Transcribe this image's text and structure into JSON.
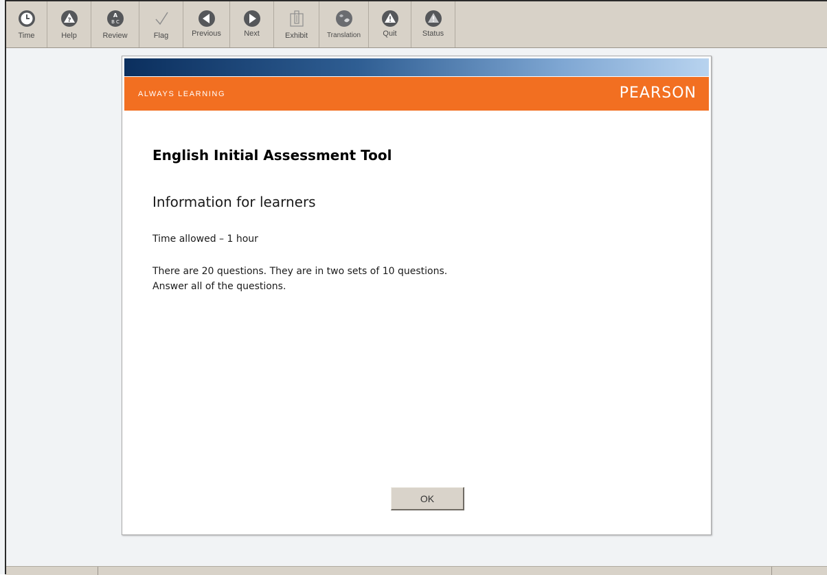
{
  "toolbar": {
    "buttons": [
      {
        "label": "Time",
        "icon": "clock-icon"
      },
      {
        "label": "Help",
        "icon": "help-icon"
      },
      {
        "label": "Review",
        "icon": "review-icon"
      },
      {
        "label": "Flag",
        "icon": "checkmark-icon"
      },
      {
        "label": "Previous",
        "icon": "arrow-left-icon"
      },
      {
        "label": "Next",
        "icon": "arrow-right-icon"
      },
      {
        "label": "Exhibit",
        "icon": "exhibit-icon"
      },
      {
        "label": "Translation",
        "icon": "translation-icon"
      },
      {
        "label": "Quit",
        "icon": "warning-icon"
      },
      {
        "label": "Status",
        "icon": "status-icon"
      }
    ]
  },
  "dialog": {
    "banner_tagline": "ALWAYS LEARNING",
    "brand": "PEARSON",
    "title": "English Initial Assessment Tool",
    "subtitle": "Information for learners",
    "time_allowed": "Time allowed – 1 hour",
    "info_line_1": "There are 20 questions. They are in two sets of 10 questions.",
    "info_line_2": "Answer all of the questions.",
    "ok_label": "OK"
  },
  "colors": {
    "brand_orange": "#f26f21",
    "toolbar_bg": "#d8d2c8",
    "icon_dark": "#55575a"
  }
}
